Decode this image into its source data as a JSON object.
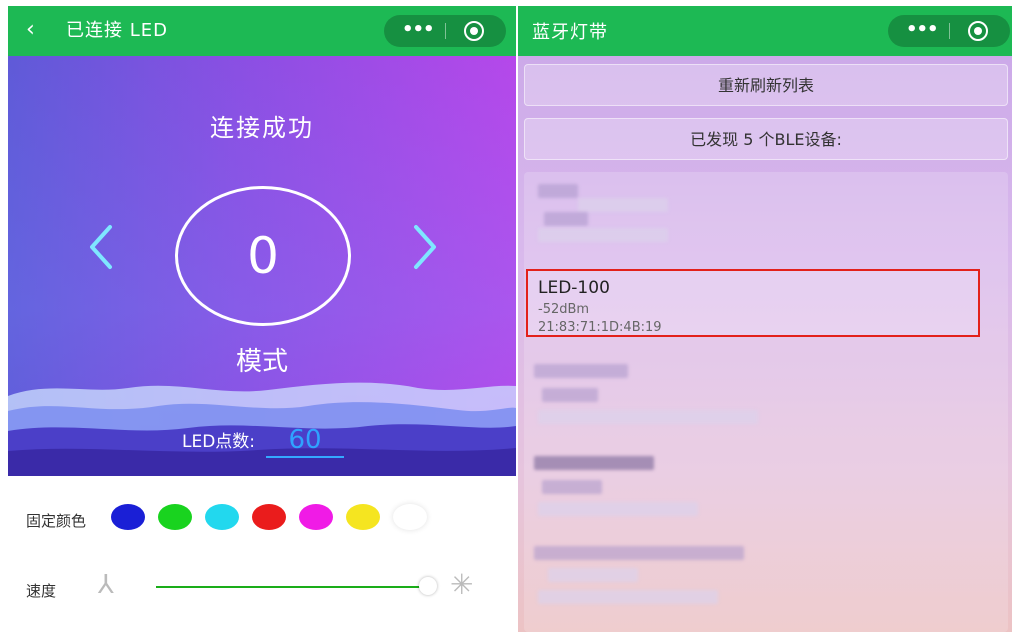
{
  "left": {
    "navbar": {
      "back_icon": "‹",
      "title": "已连接 LED"
    },
    "hero": {
      "status": "连接成功",
      "mode_value": "0",
      "mode_label": "模式",
      "led_count_label": "LED点数:",
      "led_count_value": "60"
    },
    "controls": {
      "color_label": "固定颜色",
      "colors": [
        "#1a1fd6",
        "#19d31f",
        "#22d8ee",
        "#ea1c1c",
        "#f01be6",
        "#f5e520",
        "#ffffff"
      ],
      "speed_label": "速度",
      "speed_level": 0.97,
      "accent": "#1aad19"
    }
  },
  "right": {
    "navbar": {
      "title": "蓝牙灯带"
    },
    "refresh_button": "重新刷新列表",
    "found_text": "已发现 5 个BLE设备:",
    "selected_device": {
      "name": "LED-100",
      "rssi": "-52dBm",
      "mac": "21:83:71:1D:4B:19",
      "highlight_color": "#e3211b"
    }
  },
  "theme": {
    "navbar_green": "#1db954",
    "ring_white": "#ffffff",
    "arrow_cyan": "#7fe7ff",
    "input_blue": "#2fa3ff"
  }
}
